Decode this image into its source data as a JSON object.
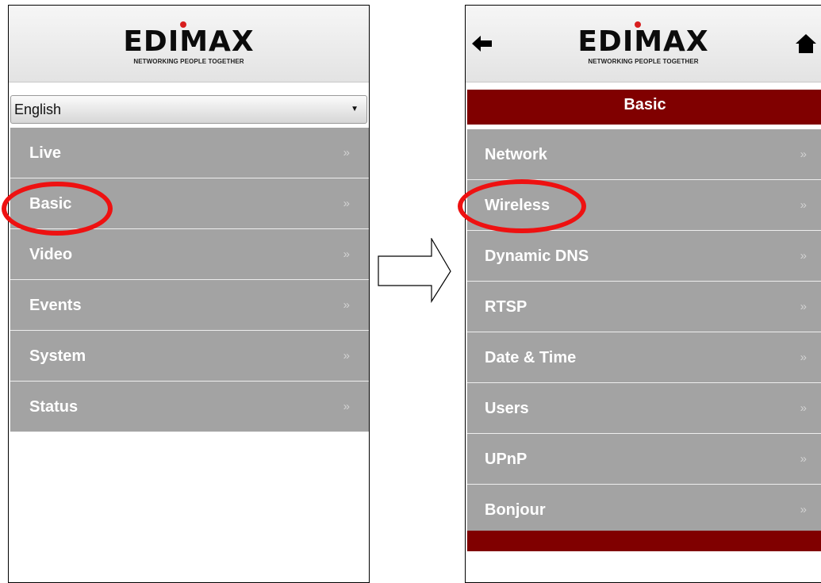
{
  "brand": {
    "name": "EDIMAX",
    "tagline": "NETWORKING PEOPLE TOGETHER",
    "dot_color": "#d81e1e"
  },
  "colors": {
    "menu_bg": "#a3a3a3",
    "section_bar": "#800000",
    "highlight": "#ee1111"
  },
  "left": {
    "language": {
      "selected": "English"
    },
    "menu": [
      {
        "label": "Live",
        "chevron": "»"
      },
      {
        "label": "Basic",
        "chevron": "»"
      },
      {
        "label": "Video",
        "chevron": "»"
      },
      {
        "label": "Events",
        "chevron": "»"
      },
      {
        "label": "System",
        "chevron": "»"
      },
      {
        "label": "Status",
        "chevron": "»"
      }
    ]
  },
  "right": {
    "icons": {
      "back": "back-arrow-icon",
      "home": "home-icon"
    },
    "section_title": "Basic",
    "menu": [
      {
        "label": "Network",
        "chevron": "»"
      },
      {
        "label": "Wireless",
        "chevron": "»"
      },
      {
        "label": "Dynamic DNS",
        "chevron": "»"
      },
      {
        "label": "RTSP",
        "chevron": "»"
      },
      {
        "label": "Date & Time",
        "chevron": "»"
      },
      {
        "label": "Users",
        "chevron": "»"
      },
      {
        "label": "UPnP",
        "chevron": "»"
      },
      {
        "label": "Bonjour",
        "chevron": "»"
      }
    ]
  }
}
